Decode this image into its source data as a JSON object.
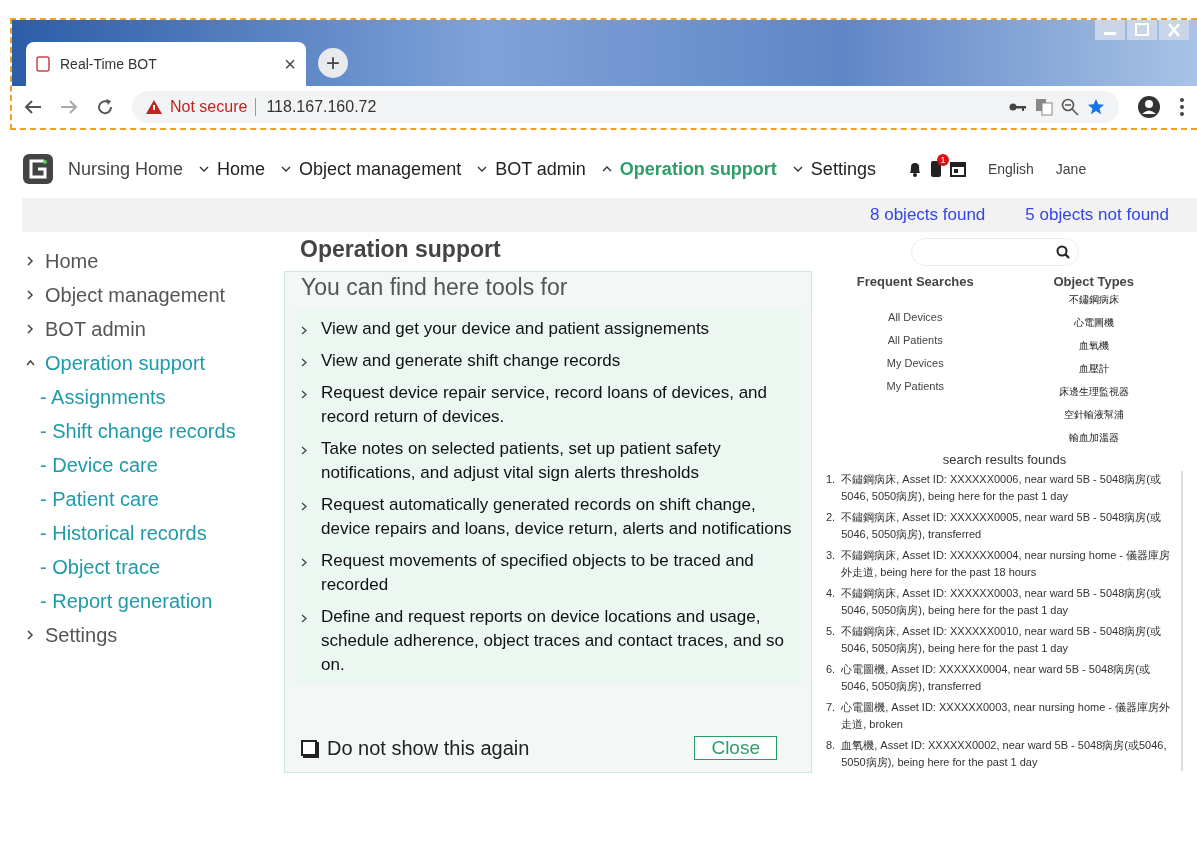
{
  "browser": {
    "tab_title": "Real-Time BOT",
    "tab_close": "×",
    "new_tab": "+",
    "security": "Not secure",
    "url": "118.167.160.72"
  },
  "nav": {
    "brand": "Nursing Home",
    "items": [
      {
        "label": "Home",
        "expanded": false,
        "selected": false
      },
      {
        "label": "Object management",
        "expanded": false,
        "selected": false
      },
      {
        "label": "BOT admin",
        "expanded": false,
        "selected": false
      },
      {
        "label": "Operation support",
        "expanded": true,
        "selected": true
      },
      {
        "label": "Settings",
        "expanded": false,
        "selected": false
      }
    ],
    "badge": "1",
    "language": "English",
    "user": "Jane"
  },
  "status": {
    "found": "8 objects found",
    "not_found": "5 objects not found"
  },
  "sidebar": {
    "items": [
      {
        "label": "Home",
        "expanded": false,
        "selected": false
      },
      {
        "label": "Object management",
        "expanded": false,
        "selected": false
      },
      {
        "label": "BOT admin",
        "expanded": false,
        "selected": false
      },
      {
        "label": "Operation support",
        "expanded": true,
        "selected": true,
        "children": [
          {
            "label": "- Assignments"
          },
          {
            "label": "- Shift change records"
          },
          {
            "label": "- Device care"
          },
          {
            "label": "- Patient care"
          },
          {
            "label": "- Historical records"
          },
          {
            "label": "- Object trace"
          },
          {
            "label": "- Report generation"
          }
        ]
      },
      {
        "label": "Settings",
        "expanded": false,
        "selected": false
      }
    ]
  },
  "dialog": {
    "title": "Operation support",
    "subtitle": "You can find here tools for",
    "items": [
      "View and get your device and patient assignements",
      "View and generate shift change records",
      "Request device repair service, record loans of devices, and record return of devices.",
      "Take notes on selected patients, set up patient safety notifications, and adjust vital sign alerts thresholds",
      "Request automatically generated records on shift change, device repairs and loans, device return, alerts and notifications",
      "Request movements of specified objects to be traced and recorded",
      "Define and request reports on device locations and usage, schedule adherence, object traces and contact traces, and so on."
    ],
    "do_not_show": {
      "label": "Do not show this again",
      "checked": false
    },
    "close": "Close"
  },
  "search_panel": {
    "frequent_searches": {
      "title": "Frequent Searches",
      "items": [
        "All Devices",
        "All Patients",
        "My Devices",
        "My Patients"
      ]
    },
    "object_types": {
      "title": "Object Types",
      "items": [
        "不鏽鋼病床",
        "心電圖機",
        "血氧機",
        "血壓計",
        "床邊生理監視器",
        "空針輸液幫浦",
        "輸血加溫器"
      ]
    },
    "results": {
      "title": "search results founds",
      "items": [
        {
          "number": "1.",
          "text": "不鏽鋼病床, Asset ID: XXXXXX0006, near ward 5B - 5048病房(或5046, 5050病房), being here for the past 1 day"
        },
        {
          "number": "2.",
          "text": "不鏽鋼病床, Asset ID: XXXXXX0005, near ward 5B - 5048病房(或5046, 5050病房), transferred"
        },
        {
          "number": "3.",
          "text": "不鏽鋼病床, Asset ID: XXXXXX0004, near nursing home - 儀器庫房外走道, being here for the past 18 hours"
        },
        {
          "number": "4.",
          "text": "不鏽鋼病床, Asset ID: XXXXXX0003, near ward 5B - 5048病房(或5046, 5050病房), being here for the past 1 day"
        },
        {
          "number": "5.",
          "text": "不鏽鋼病床, Asset ID: XXXXXX0010, near ward 5B - 5048病房(或5046, 5050病房), being here for the past 1 day"
        },
        {
          "number": "6.",
          "text": "心電圖機, Asset ID: XXXXXX0004, near ward 5B - 5048病房(或5046, 5050病房), transferred"
        },
        {
          "number": "7.",
          "text": "心電圖機, Asset ID: XXXXXX0003, near nursing home - 儀器庫房外走道, broken"
        },
        {
          "number": "8.",
          "text": "血氧機, Asset ID: XXXXXX0002, near ward 5B - 5048病房(或5046, 5050病房), being here for the past 1 day"
        }
      ]
    }
  }
}
